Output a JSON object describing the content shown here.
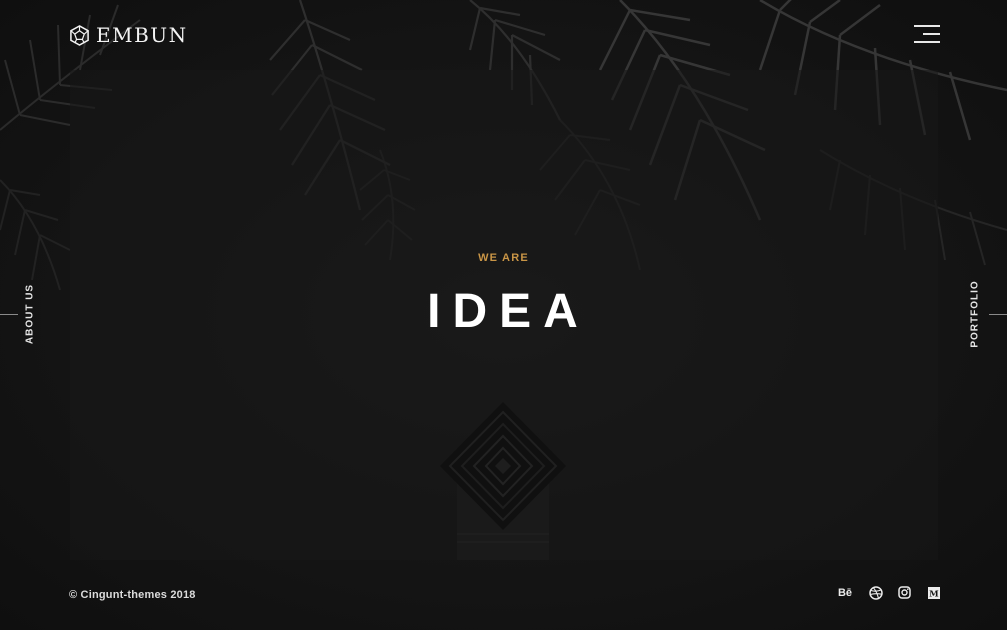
{
  "header": {
    "brand": "EMBUN",
    "logo_icon": "dodecahedron-logo-icon",
    "menu_icon": "hamburger-menu-icon"
  },
  "hero": {
    "kicker": "WE ARE",
    "title": "IDEA"
  },
  "side_nav": {
    "left_label": "ABOUT US",
    "right_label": "PORTFOLIO"
  },
  "footer": {
    "copyright": "© Cingunt-themes 2018",
    "social": [
      {
        "name": "behance",
        "label": "Bē",
        "icon": "behance-icon"
      },
      {
        "name": "dribbble",
        "label": "",
        "icon": "dribbble-icon"
      },
      {
        "name": "instagram",
        "label": "",
        "icon": "instagram-icon"
      },
      {
        "name": "medium",
        "label": "M",
        "icon": "medium-icon"
      }
    ]
  },
  "colors": {
    "background": "#131313",
    "accent": "#c99546",
    "text": "#ffffff"
  }
}
